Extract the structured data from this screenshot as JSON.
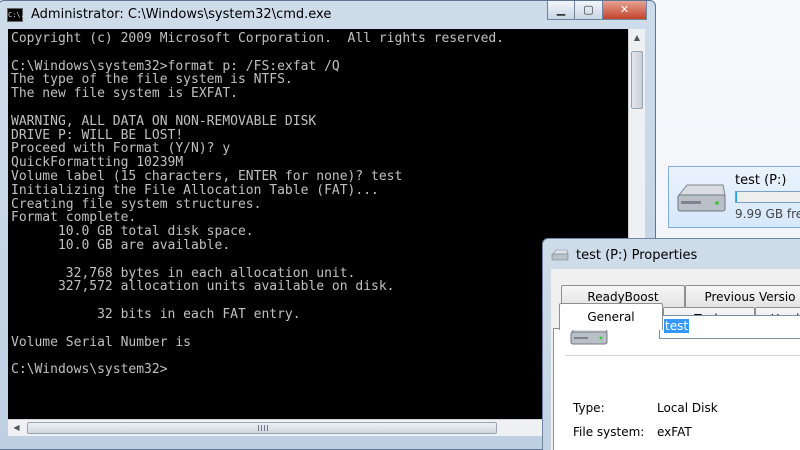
{
  "cmd": {
    "title": "Administrator: C:\\Windows\\system32\\cmd.exe",
    "icon_text": "C:\\.",
    "lines": [
      "Copyright (c) 2009 Microsoft Corporation.  All rights reserved.",
      "",
      "C:\\Windows\\system32>format p: /FS:exfat /Q",
      "The type of the file system is NTFS.",
      "The new file system is EXFAT.",
      "",
      "WARNING, ALL DATA ON NON-REMOVABLE DISK",
      "DRIVE P: WILL BE LOST!",
      "Proceed with Format (Y/N)? y",
      "QuickFormatting 10239M",
      "Volume label (15 characters, ENTER for none)? test",
      "Initializing the File Allocation Table (FAT)...",
      "Creating file system structures.",
      "Format complete.",
      "      10.0 GB total disk space.",
      "      10.0 GB are available.",
      "",
      "       32,768 bytes in each allocation unit.",
      "      327,572 allocation units available on disk.",
      "",
      "           32 bits in each FAT entry.",
      "",
      "Volume Serial Number is",
      "",
      "C:\\Windows\\system32>"
    ],
    "window_buttons": {
      "minimize": "▁",
      "maximize": "▢",
      "close": "✕"
    }
  },
  "explorer": {
    "drive_name": "test (P:)",
    "drive_free": "9.99 GB fre",
    "usage_fraction": 0.01
  },
  "properties": {
    "title": "test (P:) Properties",
    "tabs_back": [
      "ReadyBoost",
      "Previous Versio"
    ],
    "tabs_front": [
      "General",
      "Tools",
      "Hard"
    ],
    "active_tab": "General",
    "label_value": "test",
    "type_label": "Type:",
    "type_value": "Local Disk",
    "fs_label": "File system:",
    "fs_value": "exFAT"
  }
}
